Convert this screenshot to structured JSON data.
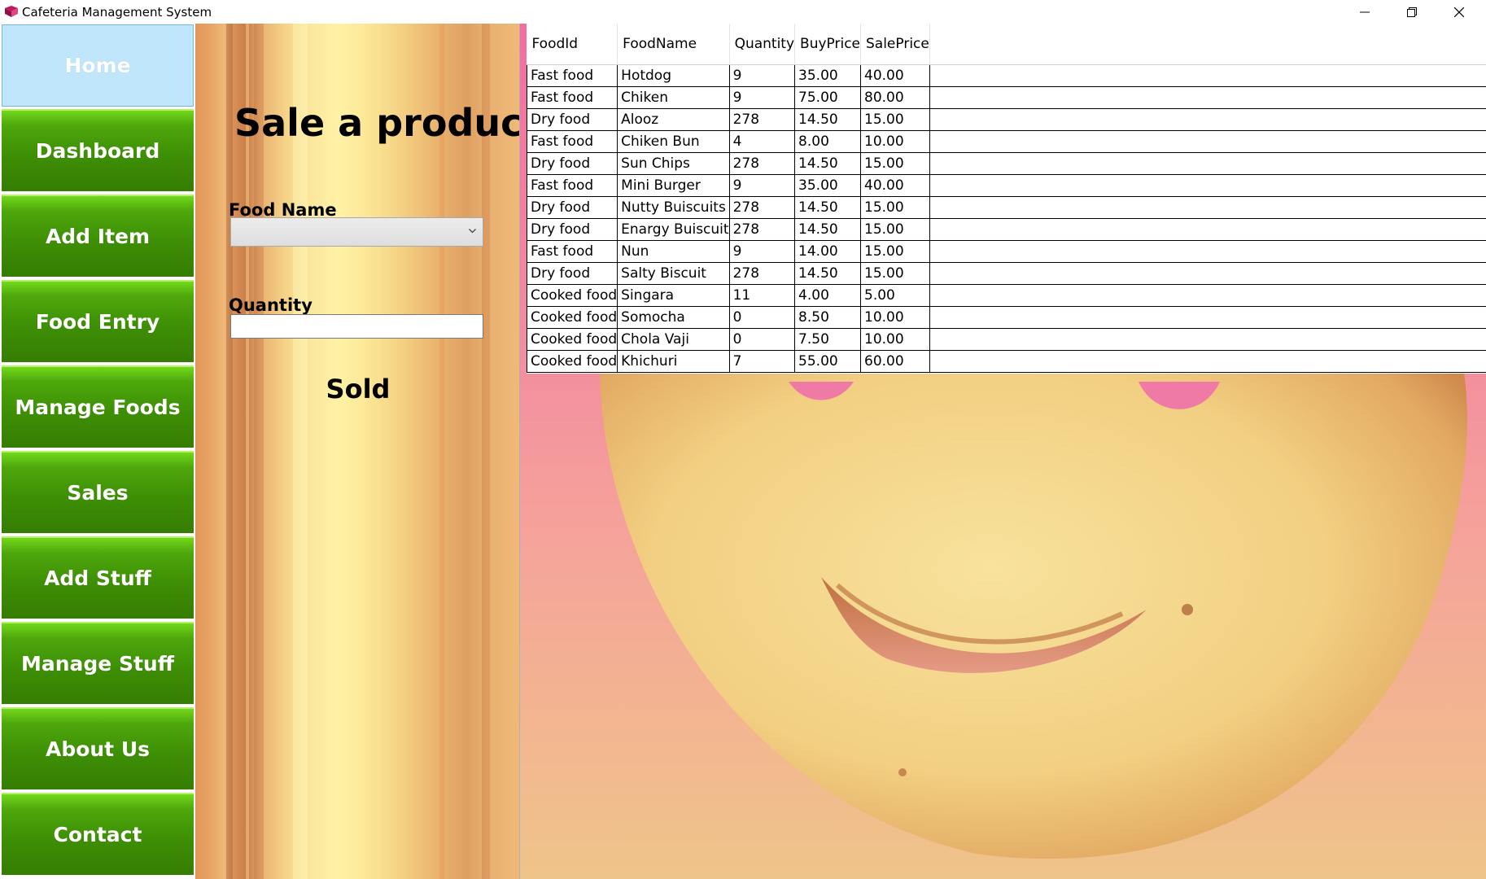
{
  "window": {
    "title": "Cafeteria Management System",
    "app_icon": "book-icon",
    "controls": [
      "minimize-icon",
      "restore-icon",
      "close-icon"
    ]
  },
  "sidebar": {
    "items": [
      {
        "label": "Home",
        "active": true
      },
      {
        "label": "Dashboard"
      },
      {
        "label": "Add Item"
      },
      {
        "label": "Food Entry"
      },
      {
        "label": "Manage Foods"
      },
      {
        "label": "Sales"
      },
      {
        "label": "Add Stuff"
      },
      {
        "label": "Manage Stuff"
      },
      {
        "label": "About Us"
      },
      {
        "label": "Contact"
      }
    ]
  },
  "form": {
    "title": "Sale a product",
    "food_name_label": "Food Name",
    "food_name_value": "",
    "quantity_label": "Quantity",
    "quantity_value": "",
    "sold_button": "Sold"
  },
  "grid": {
    "columns": [
      "FoodId",
      "FoodName",
      "Quantity",
      "BuyPrice",
      "SalePrice"
    ],
    "rows": [
      [
        "Fast food",
        "Hotdog",
        "9",
        "35.00",
        "40.00"
      ],
      [
        "Fast food",
        "Chiken",
        "9",
        "75.00",
        "80.00"
      ],
      [
        "Dry food",
        "Alooz",
        "278",
        "14.50",
        "15.00"
      ],
      [
        "Fast food",
        "Chiken Bun",
        "4",
        "8.00",
        "10.00"
      ],
      [
        "Dry food",
        "Sun Chips",
        "278",
        "14.50",
        "15.00"
      ],
      [
        "Fast food",
        "Mini Burger",
        "9",
        "35.00",
        "40.00"
      ],
      [
        "Dry food",
        "Nutty Buiscuits",
        "278",
        "14.50",
        "15.00"
      ],
      [
        "Dry food",
        "Enargy Buiscuit",
        "278",
        "14.50",
        "15.00"
      ],
      [
        "Fast food",
        "Nun",
        "9",
        "14.00",
        "15.00"
      ],
      [
        "Dry food",
        "Salty Biscuit",
        "278",
        "14.50",
        "15.00"
      ],
      [
        "Cooked food",
        "Singara",
        "11",
        "4.00",
        "5.00"
      ],
      [
        "Cooked food",
        "Somocha",
        "0",
        "8.50",
        "10.00"
      ],
      [
        "Cooked food",
        "Chola Vaji",
        "0",
        "7.50",
        "10.00"
      ],
      [
        "Cooked food",
        "Khichuri",
        "7",
        "55.00",
        "60.00"
      ]
    ]
  },
  "colors": {
    "nav_green": "#3e8f05",
    "nav_active": "#bfe6fb",
    "panel_orange": "#e8a565",
    "panel_yellow": "#fff2a6",
    "photo_pink": "#f36da3"
  }
}
